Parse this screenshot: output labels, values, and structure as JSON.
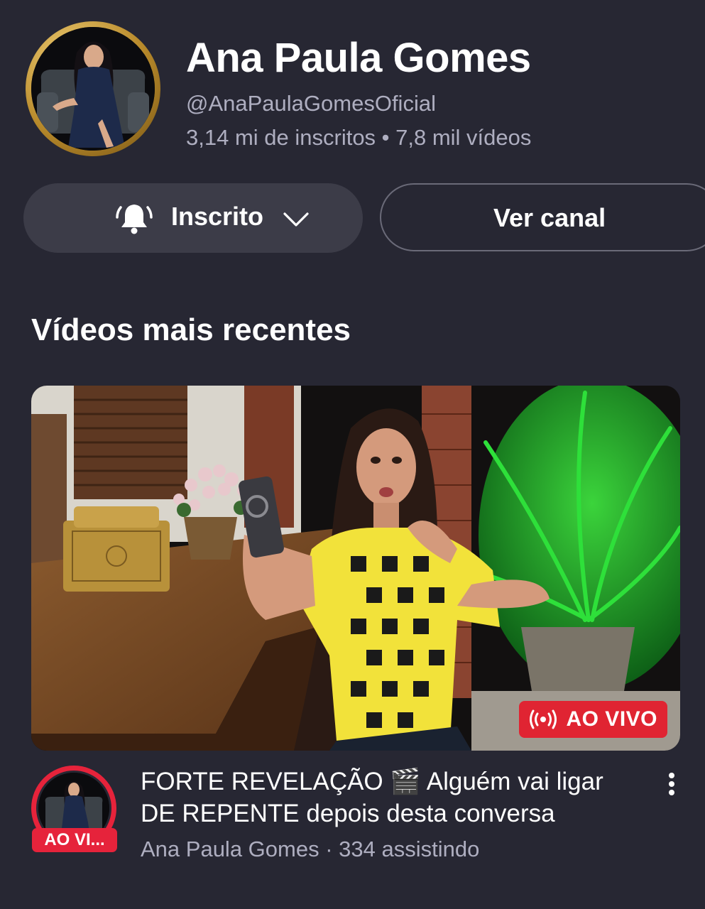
{
  "channel": {
    "name": "Ana Paula Gomes",
    "handle": "@AnaPaulaGomesOficial",
    "meta": "3,14 mi de inscritos • 7,8 mil vídeos"
  },
  "actions": {
    "subscribed_label": "Inscrito",
    "view_channel_label": "Ver canal"
  },
  "section": {
    "title": "Vídeos mais recentes"
  },
  "video": {
    "live_badge": "AO VIVO",
    "avatar_live_badge": "AO VI...",
    "title": "FORTE REVELAÇÃO 🎬 Alguém vai ligar DE REPENTE depois desta conversa",
    "meta": "Ana Paula Gomes · 334 assistindo"
  },
  "colors": {
    "background": "#272733",
    "live_red": "#e02432",
    "gold_ring": "#c89a35"
  },
  "icons": [
    "bell-ring-icon",
    "chevron-down-icon",
    "live-broadcast-icon",
    "more-vert-icon"
  ]
}
